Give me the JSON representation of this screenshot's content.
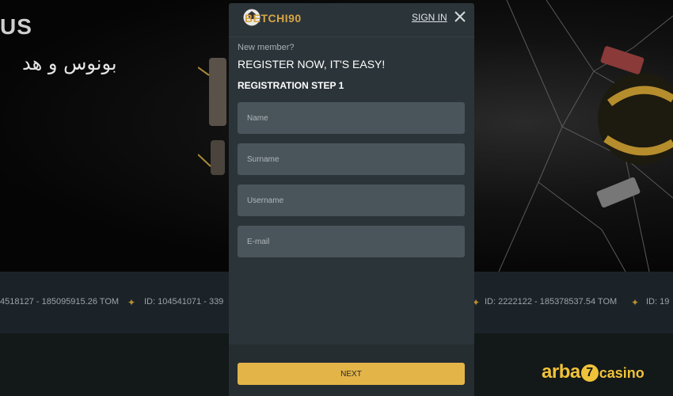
{
  "background": {
    "brand_fragment": "US",
    "arabic_text": "بونوس و هد"
  },
  "ticker": {
    "items": [
      "4518127 - 185095915.26 TOM",
      "ID: 104541071 - 339",
      "ID: 2222122 - 185378537.54 TOM",
      "ID: 19"
    ]
  },
  "modal": {
    "logo_text": "BETCHI90",
    "sign_in": "SIGN IN",
    "new_member": "New member?",
    "headline": "REGISTER NOW, IT'S EASY!",
    "step": "REGISTRATION STEP 1",
    "fields": {
      "name_placeholder": "Name",
      "surname_placeholder": "Surname",
      "username_placeholder": "Username",
      "email_placeholder": "E-mail"
    },
    "next_label": "NEXT"
  },
  "watermark": {
    "arba": "arba",
    "seven": "7",
    "casino": "casino"
  },
  "colors": {
    "accent": "#e3b448",
    "modal_bg": "#2b3439",
    "field_bg": "#4a555b",
    "watermark": "#f0c23a"
  }
}
